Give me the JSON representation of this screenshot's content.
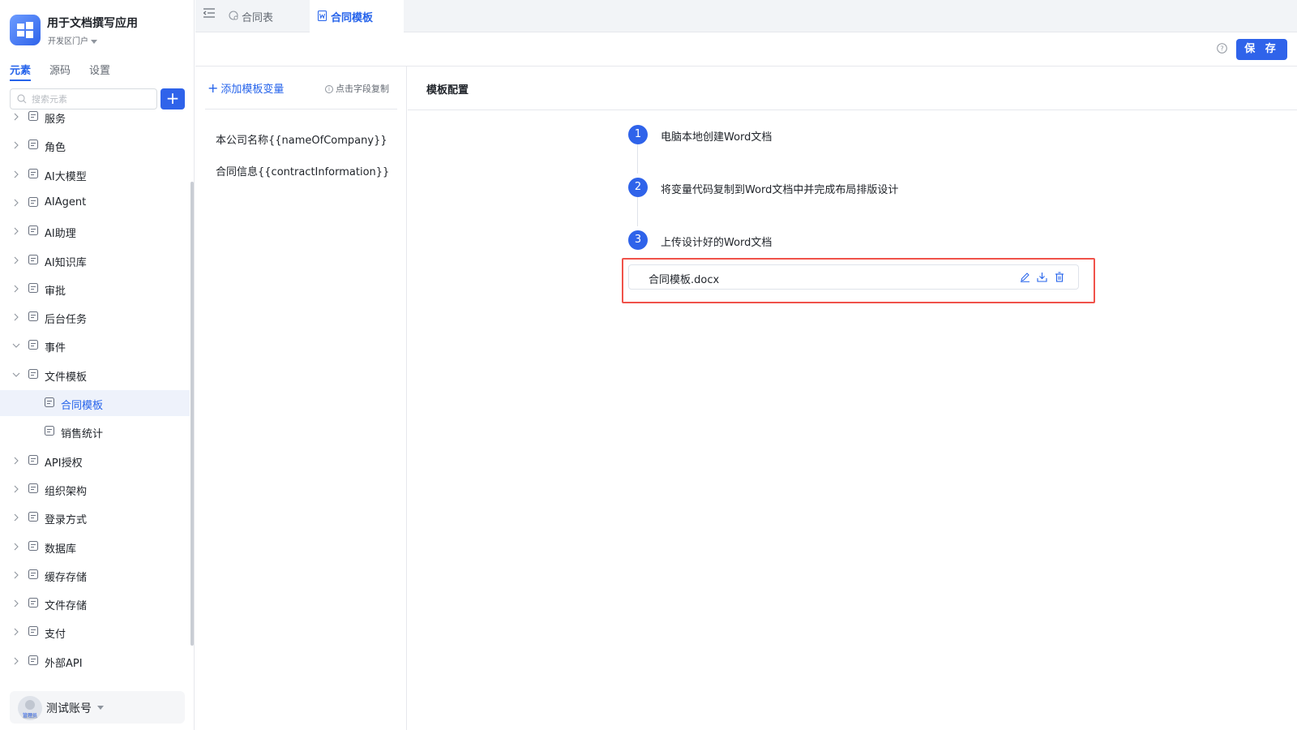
{
  "app": {
    "name": "用于文档撰写应用",
    "env": "开发区门户"
  },
  "sidebar_tabs": [
    "元素",
    "源码",
    "设置"
  ],
  "search": {
    "placeholder": "搜索元素"
  },
  "tree": [
    {
      "label": "服务",
      "icon": "service-icon",
      "expanded": false
    },
    {
      "label": "角色",
      "icon": "role-icon",
      "expanded": false
    },
    {
      "label": "AI大模型",
      "icon": "ai-model-icon",
      "expanded": false
    },
    {
      "label": "AIAgent",
      "icon": "robot-icon",
      "expanded": false
    },
    {
      "label": "AI助理",
      "icon": "ai-assistant-icon",
      "expanded": false
    },
    {
      "label": "AI知识库",
      "icon": "knowledge-base-icon",
      "expanded": false
    },
    {
      "label": "审批",
      "icon": "approval-stamp-icon",
      "expanded": false
    },
    {
      "label": "后台任务",
      "icon": "task-clipboard-icon",
      "expanded": false
    },
    {
      "label": "事件",
      "icon": "event-icon",
      "expanded": true
    },
    {
      "label": "文件模板",
      "icon": "file-template-icon",
      "expanded": true
    },
    {
      "label": "合同模板",
      "icon": "word-file-icon",
      "child": true,
      "selected": true
    },
    {
      "label": "销售统计",
      "icon": "excel-file-icon",
      "child": true
    },
    {
      "label": "API授权",
      "icon": "api-key-icon",
      "expanded": false
    },
    {
      "label": "组织架构",
      "icon": "org-chart-icon",
      "expanded": false
    },
    {
      "label": "登录方式",
      "icon": "login-icon",
      "expanded": false
    },
    {
      "label": "数据库",
      "icon": "database-icon",
      "expanded": false
    },
    {
      "label": "缓存存储",
      "icon": "cache-icon",
      "expanded": false
    },
    {
      "label": "文件存储",
      "icon": "file-storage-icon",
      "expanded": false
    },
    {
      "label": "支付",
      "icon": "payment-icon",
      "expanded": false
    },
    {
      "label": "外部API",
      "icon": "external-api-icon",
      "expanded": false
    }
  ],
  "user": {
    "name": "测试账号",
    "role": "管理员"
  },
  "tabs": [
    {
      "label": "合同表",
      "icon": "table-icon",
      "active": false
    },
    {
      "label": "合同模板",
      "icon": "word-file-icon",
      "active": true
    }
  ],
  "toolbar": {
    "save_label": "保 存"
  },
  "variables": {
    "add_label": "添加模板变量",
    "hint": "点击字段复制",
    "items": [
      "本公司名称{{nameOfCompany}}",
      "合同信息{{contractInformation}}"
    ]
  },
  "config": {
    "title": "模板配置",
    "steps": [
      {
        "num": "1",
        "text": "电脑本地创建Word文档"
      },
      {
        "num": "2",
        "text": "将变量代码复制到Word文档中并完成布局排版设计"
      },
      {
        "num": "3",
        "text": "上传设计好的Word文档"
      }
    ],
    "file_name": "合同模板.docx"
  },
  "colors": {
    "primary": "#2f63ea",
    "highlight": "#f0524a"
  }
}
